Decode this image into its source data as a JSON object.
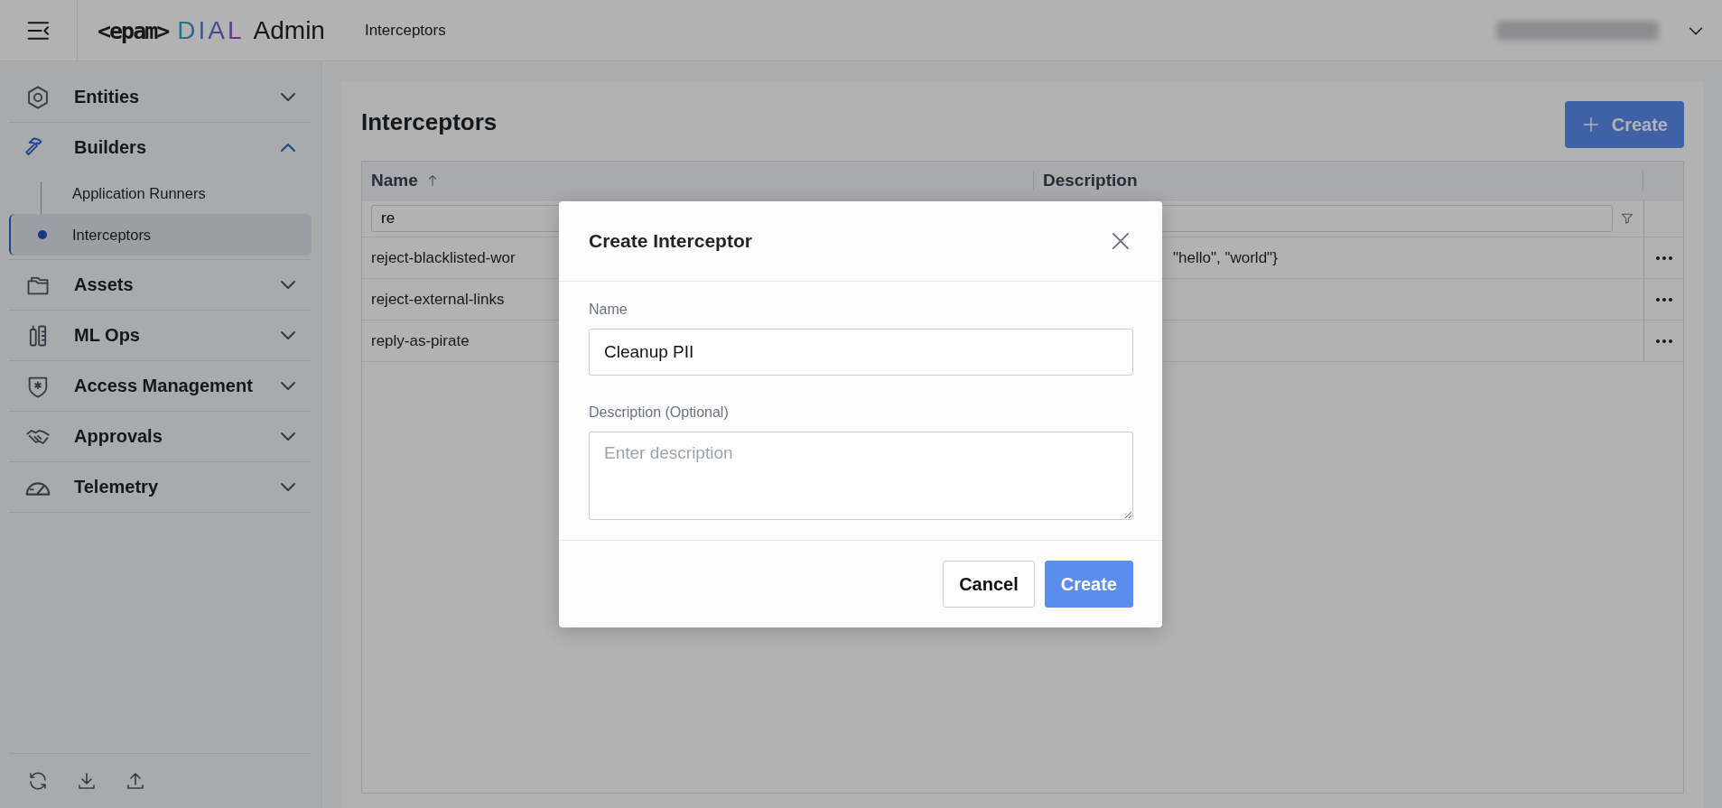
{
  "header": {
    "logo": {
      "brand": "<epam>",
      "product": "DIAL",
      "suffix": "Admin"
    },
    "breadcrumb": "Interceptors"
  },
  "sidebar": {
    "items": [
      {
        "label": "Entities",
        "expanded": false
      },
      {
        "label": "Builders",
        "expanded": true,
        "children": [
          {
            "label": "Application Runners",
            "selected": false
          },
          {
            "label": "Interceptors",
            "selected": true
          }
        ]
      },
      {
        "label": "Assets",
        "expanded": false
      },
      {
        "label": "ML Ops",
        "expanded": false
      },
      {
        "label": "Access Management",
        "expanded": false
      },
      {
        "label": "Approvals",
        "expanded": false
      },
      {
        "label": "Telemetry",
        "expanded": false
      }
    ]
  },
  "page": {
    "title": "Interceptors",
    "create_button": "Create"
  },
  "table": {
    "columns": [
      {
        "label": "Name",
        "sorted": true,
        "filter": "re"
      },
      {
        "label": "Description",
        "sorted": false
      }
    ],
    "rows": [
      {
        "name": "reject-blacklisted-wor",
        "description": "\"hello\", \"world\"}"
      },
      {
        "name": "reject-external-links"
      },
      {
        "name": "reply-as-pirate"
      }
    ]
  },
  "modal": {
    "title": "Create Interceptor",
    "fields": [
      {
        "kind": "input",
        "label": "Name",
        "value": "Cleanup PII"
      },
      {
        "kind": "textarea",
        "label": "Description (Optional)",
        "placeholder": "Enter description"
      }
    ],
    "buttons": [
      {
        "label": "Cancel",
        "kind": "secondary"
      },
      {
        "label": "Create",
        "kind": "primary"
      }
    ]
  }
}
